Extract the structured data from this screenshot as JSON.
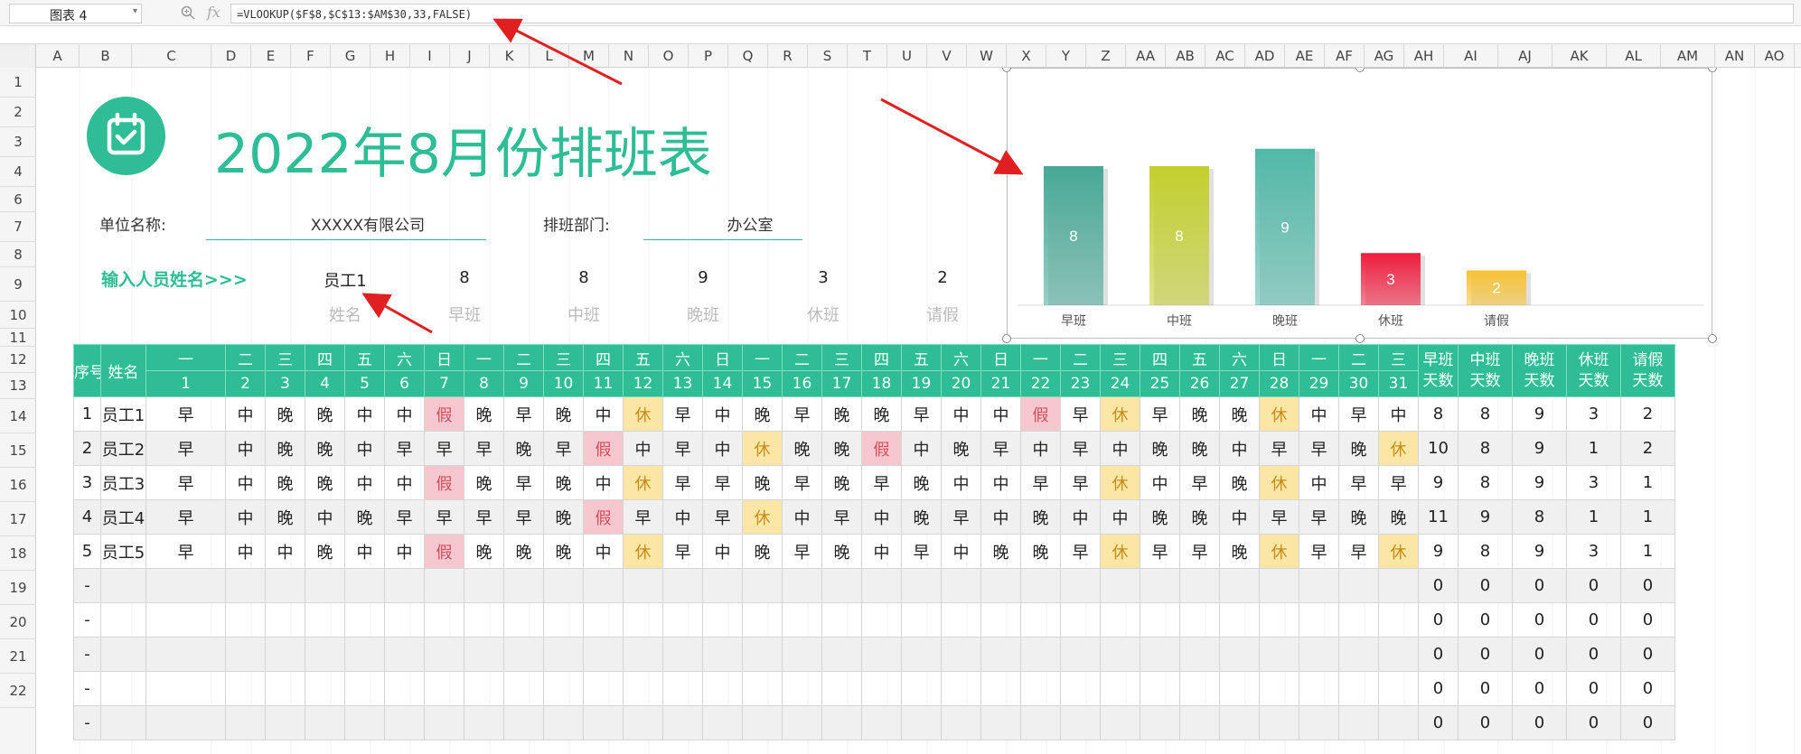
{
  "toolbar": {
    "name_box": "图表 4",
    "formula": "=VLOOKUP($F$8,$C$13:$AM$30,33,FALSE)"
  },
  "columns": [
    "A",
    "B",
    "C",
    "D",
    "E",
    "F",
    "G",
    "H",
    "I",
    "J",
    "K",
    "L",
    "M",
    "N",
    "O",
    "P",
    "Q",
    "R",
    "S",
    "T",
    "U",
    "V",
    "W",
    "X",
    "Y",
    "Z",
    "AA",
    "AB",
    "AC",
    "AD",
    "AE",
    "AF",
    "AG",
    "AH",
    "AI",
    "AJ",
    "AK",
    "AL",
    "AM",
    "AN",
    "AO"
  ],
  "rows": [
    "1",
    "2",
    "3",
    "4",
    "6",
    "7",
    "8",
    "9",
    "10",
    "11",
    "12",
    "13",
    "14",
    "15",
    "16",
    "17",
    "18",
    "19",
    "20",
    "21",
    "22"
  ],
  "header": {
    "title": "2022年8月份排班表",
    "unit_label": "单位名称:",
    "unit_value": "XXXXX有限公司",
    "dept_label": "排班部门:",
    "dept_value": "办公室",
    "input_label": "输入人员姓名>>>"
  },
  "lookup": {
    "values": [
      "员工1",
      "8",
      "8",
      "9",
      "3",
      "2"
    ],
    "labels": [
      "姓名",
      "早班",
      "中班",
      "晚班",
      "休班",
      "请假"
    ]
  },
  "chart_data": {
    "type": "bar",
    "categories": [
      "早班",
      "中班",
      "晚班",
      "休班",
      "请假"
    ],
    "values": [
      8,
      8,
      9,
      3,
      2
    ],
    "ylim": [
      0,
      10
    ],
    "colors": [
      "#47a896",
      "#c3cf2c",
      "#52b8a8",
      "#f01d3e",
      "#f8c234"
    ],
    "grid": false,
    "data_labels": true
  },
  "table": {
    "col_seq": "序号",
    "col_name": "姓名",
    "weekdays": [
      "一",
      "二",
      "三",
      "四",
      "五",
      "六",
      "日",
      "一",
      "二",
      "三",
      "四",
      "五",
      "六",
      "日",
      "一",
      "二",
      "三",
      "四",
      "五",
      "六",
      "日",
      "一",
      "二",
      "三",
      "四",
      "五",
      "六",
      "日",
      "一",
      "二",
      "三"
    ],
    "dates": [
      "1",
      "2",
      "3",
      "4",
      "5",
      "6",
      "7",
      "8",
      "9",
      "10",
      "11",
      "12",
      "13",
      "14",
      "15",
      "16",
      "17",
      "18",
      "19",
      "20",
      "21",
      "22",
      "23",
      "24",
      "25",
      "26",
      "27",
      "28",
      "29",
      "30",
      "31"
    ],
    "summary_headers": [
      [
        "早班",
        "天数"
      ],
      [
        "中班",
        "天数"
      ],
      [
        "晚班",
        "天数"
      ],
      [
        "休班",
        "天数"
      ],
      [
        "请假",
        "天数"
      ]
    ],
    "rows": [
      {
        "seq": "1",
        "name": "员工1",
        "shifts": [
          "早",
          "中",
          "晚",
          "晚",
          "中",
          "中",
          "假",
          "晚",
          "早",
          "晚",
          "中",
          "休",
          "早",
          "中",
          "晚",
          "早",
          "晚",
          "晚",
          "早",
          "中",
          "中",
          "假",
          "早",
          "休",
          "早",
          "晚",
          "晚",
          "休",
          "中",
          "早",
          "中"
        ],
        "totals": [
          "8",
          "8",
          "9",
          "3",
          "2"
        ]
      },
      {
        "seq": "2",
        "name": "员工2",
        "shifts": [
          "早",
          "中",
          "晚",
          "晚",
          "中",
          "早",
          "早",
          "早",
          "晚",
          "早",
          "假",
          "中",
          "早",
          "中",
          "休",
          "晚",
          "晚",
          "假",
          "中",
          "晚",
          "早",
          "中",
          "早",
          "中",
          "晚",
          "晚",
          "中",
          "早",
          "早",
          "晚",
          "休"
        ],
        "totals": [
          "10",
          "8",
          "9",
          "1",
          "2"
        ]
      },
      {
        "seq": "3",
        "name": "员工3",
        "shifts": [
          "早",
          "中",
          "晚",
          "晚",
          "中",
          "中",
          "假",
          "晚",
          "早",
          "晚",
          "中",
          "休",
          "早",
          "早",
          "晚",
          "早",
          "晚",
          "早",
          "晚",
          "中",
          "中",
          "早",
          "早",
          "休",
          "中",
          "早",
          "晚",
          "休",
          "中",
          "早",
          "早"
        ],
        "totals": [
          "9",
          "8",
          "9",
          "3",
          "1"
        ]
      },
      {
        "seq": "4",
        "name": "员工4",
        "shifts": [
          "早",
          "中",
          "晚",
          "中",
          "晚",
          "早",
          "早",
          "早",
          "早",
          "晚",
          "假",
          "早",
          "中",
          "早",
          "休",
          "中",
          "早",
          "中",
          "晚",
          "早",
          "中",
          "晚",
          "中",
          "中",
          "晚",
          "晚",
          "中",
          "早",
          "早",
          "晚",
          "晚"
        ],
        "totals": [
          "11",
          "9",
          "8",
          "1",
          "1"
        ]
      },
      {
        "seq": "5",
        "name": "员工5",
        "shifts": [
          "早",
          "中",
          "中",
          "晚",
          "中",
          "中",
          "假",
          "晚",
          "晚",
          "晚",
          "中",
          "休",
          "早",
          "中",
          "晚",
          "早",
          "晚",
          "中",
          "早",
          "中",
          "晚",
          "晚",
          "早",
          "休",
          "早",
          "早",
          "晚",
          "休",
          "早",
          "早",
          "休"
        ],
        "totals": [
          "9",
          "8",
          "9",
          "3",
          "1"
        ]
      },
      {
        "seq": "-",
        "name": "",
        "shifts": [],
        "totals": [
          "0",
          "0",
          "0",
          "0",
          "0"
        ]
      },
      {
        "seq": "-",
        "name": "",
        "shifts": [],
        "totals": [
          "0",
          "0",
          "0",
          "0",
          "0"
        ]
      },
      {
        "seq": "-",
        "name": "",
        "shifts": [],
        "totals": [
          "0",
          "0",
          "0",
          "0",
          "0"
        ]
      },
      {
        "seq": "-",
        "name": "",
        "shifts": [],
        "totals": [
          "0",
          "0",
          "0",
          "0",
          "0"
        ]
      },
      {
        "seq": "-",
        "name": "",
        "shifts": [],
        "totals": [
          "0",
          "0",
          "0",
          "0",
          "0"
        ]
      }
    ]
  }
}
